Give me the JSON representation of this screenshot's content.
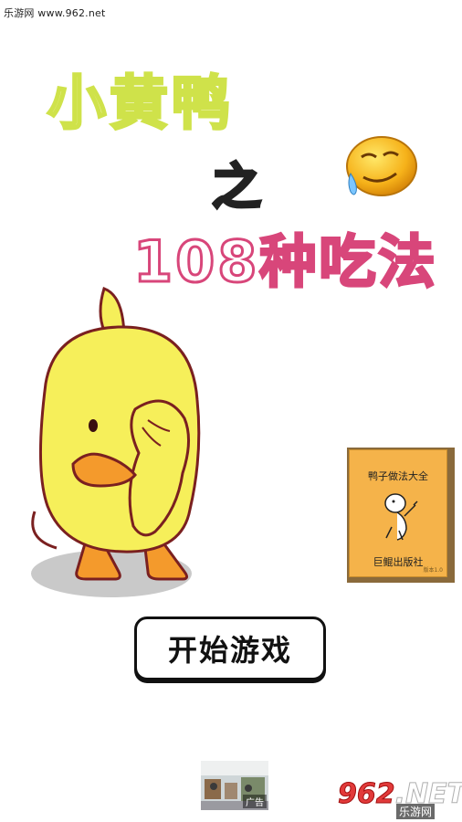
{
  "watermark": "乐游网 www.962.net",
  "title": {
    "line1": "小黄鸭",
    "line2": "之",
    "line3": "108种吃法"
  },
  "book": {
    "title": "鸭子做法大全",
    "publisher": "巨鲲出版社",
    "version": "版本1.0"
  },
  "start_button": "开始游戏",
  "ad": {
    "label": "广告"
  },
  "logo": {
    "num_a": "962",
    "num_b": ".NET",
    "sub": "乐游网"
  },
  "icons": {
    "emoji": "drooling-emoji-icon",
    "duck": "yellow-duck-character",
    "book_figure": "stick-figure-icon"
  }
}
